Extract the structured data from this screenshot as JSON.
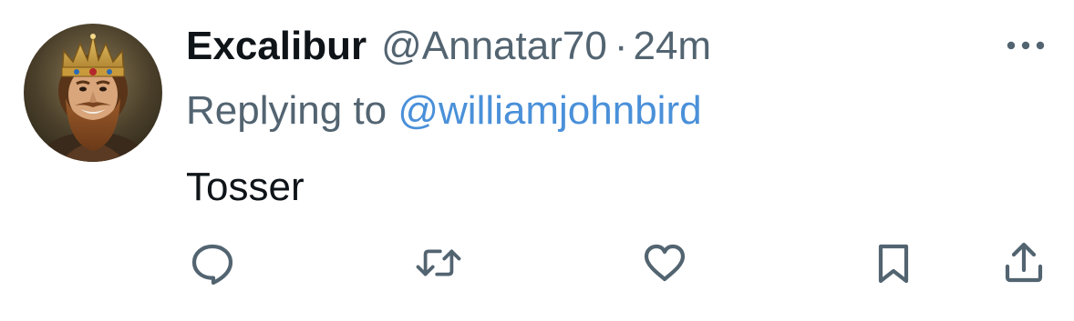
{
  "tweet": {
    "display_name": "Excalibur",
    "handle": "@Annatar70",
    "separator": "·",
    "timestamp": "24m",
    "replying_label": "Replying to ",
    "replying_to": "@williamjohnbird",
    "text": "Tosser"
  },
  "icons": {
    "more": "more-horizontal-icon",
    "reply": "reply-bubble-icon",
    "retweet": "retweet-icon",
    "like": "heart-icon",
    "bookmark": "bookmark-icon",
    "share": "share-upload-icon"
  },
  "colors": {
    "text_primary": "#0f1419",
    "text_secondary": "#536471",
    "link": "#4a90d9",
    "icon": "#536471"
  }
}
